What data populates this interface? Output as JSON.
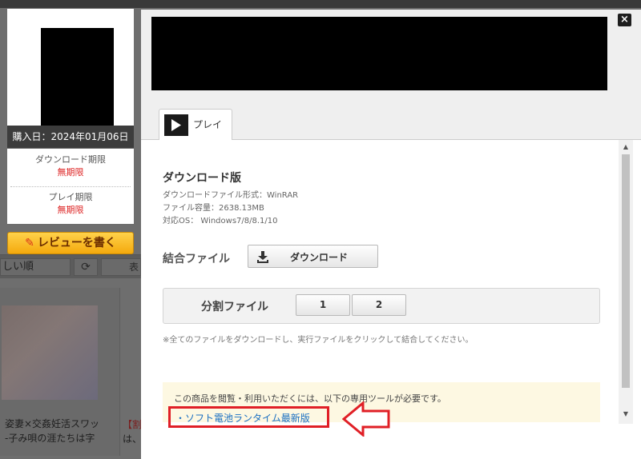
{
  "background": {
    "sort_select": "しい順",
    "refresh_icon": "refresh-icon",
    "more_label": "表",
    "card1_title_line1": "姿妻×交姦妊活スワッ",
    "card1_title_line2": "-子み唄の涯たちは字",
    "card2_title_line1": "【割",
    "card2_title_line2": "は、"
  },
  "sidebar": {
    "purchase_date": "購入日：2024年01月06日",
    "download_period_label": "ダウンロード期限",
    "download_period_value": "無期限",
    "play_period_label": "プレイ期限",
    "play_period_value": "無期限",
    "review_button": "レビューを書く"
  },
  "modal": {
    "close_icon": "×",
    "tab_label": "プレイ",
    "download_title": "ダウンロード版",
    "info_format": "ダウンロードファイル形式：WinRAR",
    "info_size": "ファイル容量：2638.13MB",
    "info_os": "対応OS： Windows7/8/8.1/10",
    "combined_label": "結合ファイル",
    "download_button": "ダウンロード",
    "split_label": "分割ファイル",
    "split_parts": [
      "1",
      "2"
    ],
    "note": "※全てのファイルをダウンロードし、実行ファイルをクリックして結合してください。",
    "tool_notice": "この商品を閲覧・利用いただくには、以下の専用ツールが必要です。",
    "tool_link": "・ソフト電池ランタイム最新版"
  },
  "colors": {
    "accent_red": "#e01f26",
    "link_blue": "#1a6fc2",
    "review_orange": "#f4a90d",
    "notice_bg": "#fdf8e2"
  }
}
